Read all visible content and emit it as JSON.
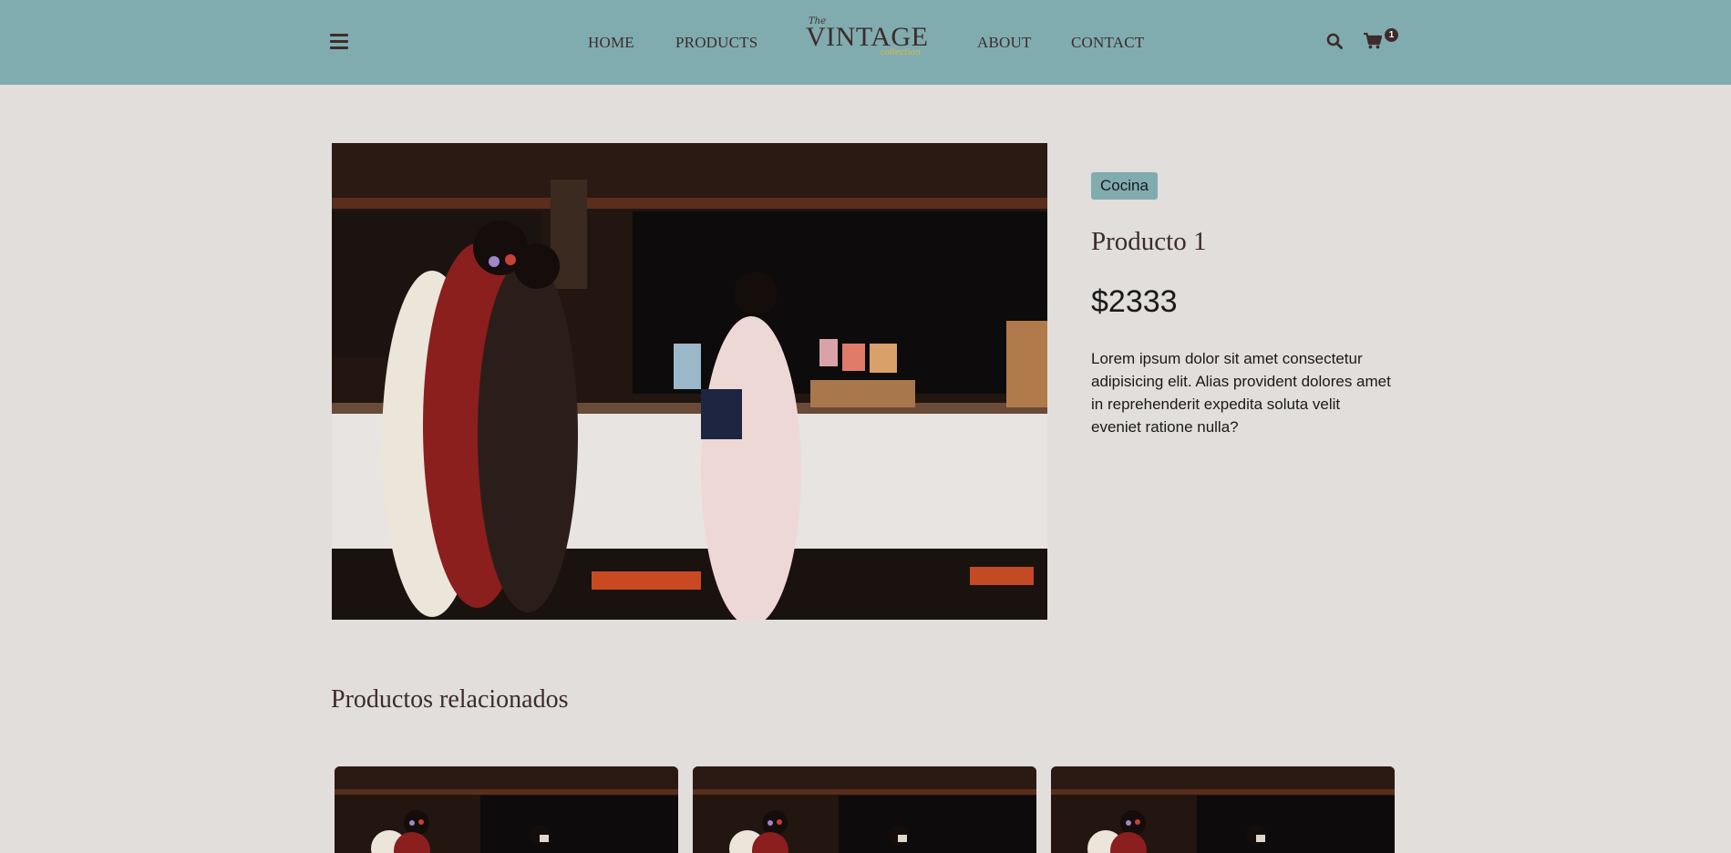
{
  "header": {
    "menu_icon": "hamburger-icon",
    "nav": {
      "home": "HOME",
      "products": "PRODUCTS",
      "about": "ABOUT",
      "contact": "CONTACT"
    },
    "logo": {
      "the": "The",
      "main": "VINTAGE",
      "sub": "collection"
    },
    "search_icon": "search-icon",
    "cart_icon": "cart-icon",
    "cart_count": "1"
  },
  "product": {
    "image_description": "kimono-photo",
    "category": "Cocina",
    "title": "Producto 1",
    "price": "$2333",
    "description": "Lorem ipsum dolor sit amet consectetur adipisicing elit. Alias provident dolores amet in reprehenderit expedita soluta velit eveniet ratione nulla?"
  },
  "related": {
    "title": "Productos relacionados",
    "cards_count_visible": 3
  },
  "colors": {
    "header_bg": "#80acaf",
    "page_bg": "#e1dedb",
    "text_dark": "#3d2b2b",
    "accent_gold": "#d7b94a"
  }
}
